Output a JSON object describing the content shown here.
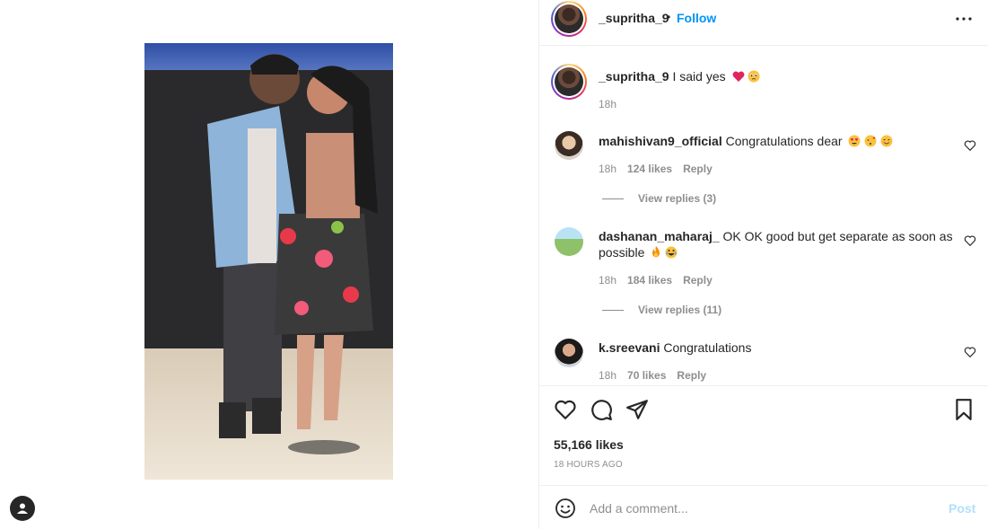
{
  "post": {
    "author": "_supritha_9",
    "dot": "•",
    "follow_label": "Follow",
    "caption": "I said yes",
    "caption_emoji": [
      "red-heart",
      "pleading-face"
    ],
    "caption_time": "18h",
    "likes": "55,166 likes",
    "time_ago": "18 HOURS AGO"
  },
  "comments": [
    {
      "user": "mahishivan9_official",
      "text": "Congratulations dear",
      "emoji": [
        "heart-eyes",
        "kissing-heart",
        "smiling-face"
      ],
      "time": "18h",
      "likes": "124 likes",
      "reply": "Reply",
      "view_replies": "View replies (3)"
    },
    {
      "user": "dashanan_maharaj_",
      "text": "OK OK good but get separate as soon as possible",
      "emoji": [
        "fire",
        "laughing-face"
      ],
      "time": "18h",
      "likes": "184 likes",
      "reply": "Reply",
      "view_replies": "View replies (11)"
    },
    {
      "user": "k.sreevani",
      "text": "Congratulations",
      "emoji": [],
      "time": "18h",
      "likes": "70 likes",
      "reply": "Reply"
    }
  ],
  "add_comment": {
    "placeholder": "Add a comment...",
    "post_label": "Post"
  },
  "colors": {
    "accent": "#0095f6",
    "post_disabled": "#b2dffc",
    "muted": "#8e8e8e",
    "like_heart": "#ed4956"
  },
  "icons": [
    "more-horizontal-icon",
    "heart-icon",
    "comment-icon",
    "share-icon",
    "bookmark-icon",
    "emoji-icon",
    "profile-icon"
  ]
}
